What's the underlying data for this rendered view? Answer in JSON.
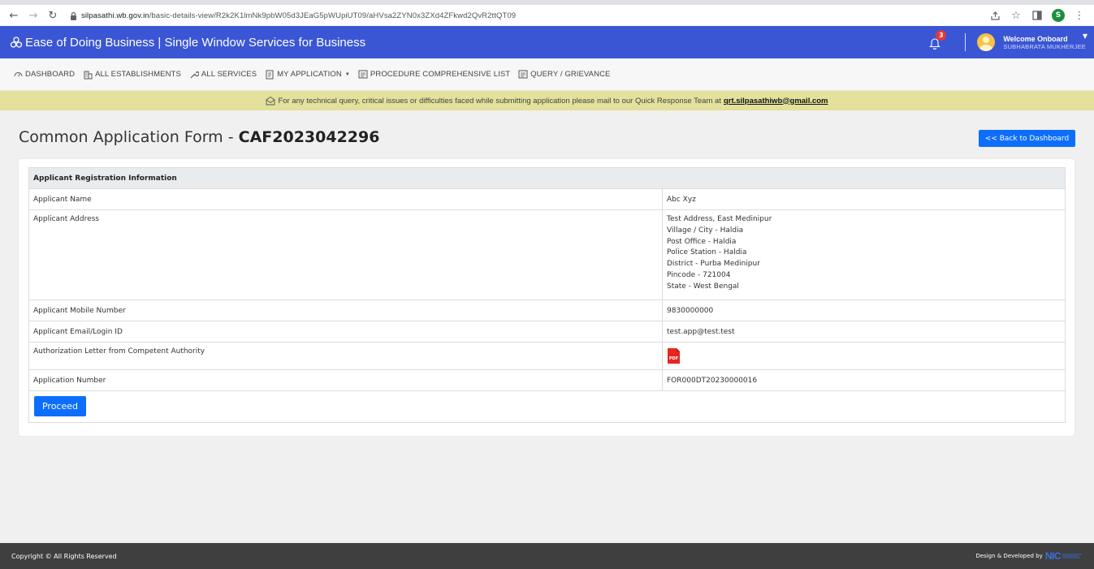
{
  "browser": {
    "url_host": "silpasathi.wb.gov.in",
    "url_path": "/basic-details-view/R2k2K1lmNk9pbW05d3JEaG5pWUpiUT09/aHVsa2ZYN0x3ZXd4ZFkwd2QvR2ttQT09",
    "profile_initial": "S"
  },
  "header": {
    "brand": "Ease of Doing Business | Single Window Services for Business",
    "notification_count": "3",
    "welcome": "Welcome Onboard",
    "user_name": "SUBHABRATA MUKHERJEE"
  },
  "nav": {
    "dashboard": "DASHBOARD",
    "establishments": "ALL ESTABLISHMENTS",
    "services": "ALL SERVICES",
    "my_application": "MY APPLICATION",
    "procedure": "PROCEDURE COMPREHENSIVE LIST",
    "query": "QUERY / GRIEVANCE"
  },
  "notice": {
    "text": "For any technical query, critical issues or difficulties faced while submitting application please mail to our Quick Response Team at",
    "email": "qrt.silpasathiwb@gmail.com"
  },
  "page": {
    "title_prefix": "Common Application Form - ",
    "form_id": "CAF2023042296",
    "back_button": "<< Back to Dashboard"
  },
  "table": {
    "heading": "Applicant Registration Information",
    "rows": [
      {
        "label": "Applicant Name",
        "value": "Abc Xyz"
      },
      {
        "label": "Applicant Address"
      },
      {
        "label": "Applicant Mobile Number",
        "value": "9830000000"
      },
      {
        "label": "Applicant Email/Login ID",
        "value": "test.app@test.test"
      },
      {
        "label": "Authorization Letter from Competent Authority",
        "value_icon": "pdf-file-icon"
      },
      {
        "label": "Application Number",
        "value": "FOR000DT20230000016"
      }
    ],
    "address_lines": [
      "Test Address, East Medinipur",
      "Village / City - Haldia",
      "Post Office - Haldia",
      "Police Station - Haldia",
      "District - Purba Medinipur",
      "Pincode - 721004",
      "State - West Bengal"
    ],
    "proceed": "Proceed"
  },
  "footer": {
    "copyright": "Copyright © All Rights Reserved",
    "developed_by": "Design & Developed by",
    "logo": "NIC"
  },
  "colors": {
    "header_bg": "#3a56d4",
    "primary_button": "#0d6efd",
    "notice_bg": "#e3e19c",
    "footer_bg": "#3f3f3f",
    "badge": "#e53935"
  }
}
